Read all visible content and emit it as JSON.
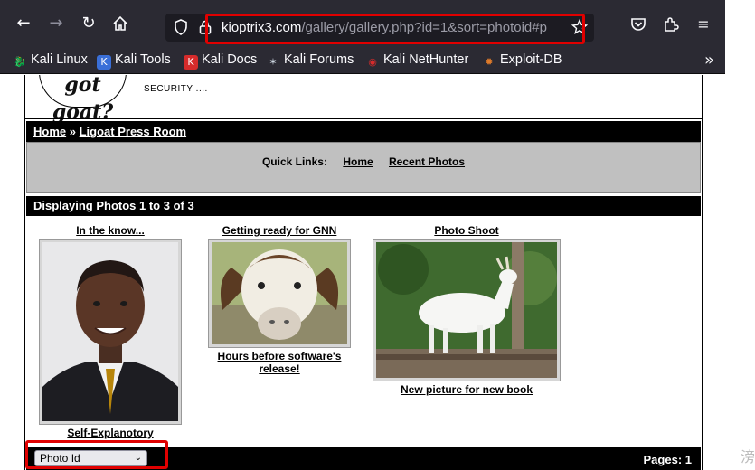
{
  "toolbar": {
    "back_icon": "arrow-left",
    "forward_icon": "arrow-right",
    "reload_icon": "reload",
    "home_icon": "home"
  },
  "url": {
    "domain": "kioptrix3.com",
    "path": "/gallery/gallery.php?id=1&sort=photoid#p"
  },
  "bookmarks": [
    {
      "label": "Kali Linux",
      "icon": "kali-dragon",
      "color": "#cfd8e3"
    },
    {
      "label": "Kali Tools",
      "icon": "kali-tools",
      "color": "#3a6fd8"
    },
    {
      "label": "Kali Docs",
      "icon": "kali-docs",
      "color": "#d62b2b"
    },
    {
      "label": "Kali Forums",
      "icon": "kali-forums",
      "color": "#cfd8e3"
    },
    {
      "label": "Kali NetHunter",
      "icon": "nethunter",
      "color": "#d62b2b"
    },
    {
      "label": "Exploit-DB",
      "icon": "exploit-db",
      "color": "#e07b2a"
    }
  ],
  "site": {
    "logo_text": "got goat?",
    "tagline": "SECURITY ....",
    "breadcrumb_home": "Home",
    "breadcrumb_sep": "»",
    "breadcrumb_current": "Ligoat Press Room",
    "quick_links_label": "Quick Links:",
    "quick_link_home": "Home",
    "quick_link_recent": "Recent Photos",
    "display_text": "Displaying Photos 1 to 3 of 3",
    "sort_selected": "Photo Id",
    "pages_text": "Pages: 1"
  },
  "photos": [
    {
      "title": "In the know...",
      "caption": "Self-Explanotory",
      "subject": "man-portrait"
    },
    {
      "title": "Getting ready for GNN",
      "caption": "Hours before software's release!",
      "subject": "goat-closeup"
    },
    {
      "title": "Photo Shoot",
      "caption": "New picture for new book",
      "subject": "white-goat"
    }
  ],
  "gutter_char": "滂",
  "colors": {
    "highlight": "#e00000",
    "chrome": "#2b2a33",
    "urlbar": "#1c1b22"
  }
}
